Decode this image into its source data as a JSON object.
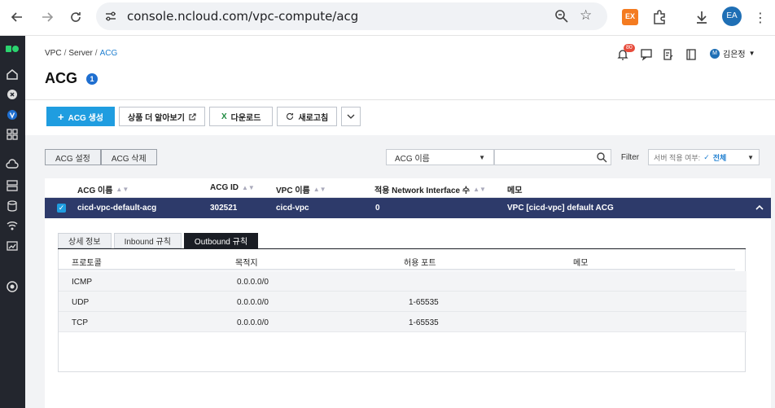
{
  "browser": {
    "url": "console.ncloud.com/vpc-compute/acg",
    "profile_initials": "EA",
    "extension_label": "EX"
  },
  "header": {
    "breadcrumb": [
      "VPC",
      "Server",
      "ACG"
    ],
    "title": "ACG",
    "title_badge": "1",
    "notification_count": "80",
    "user_initial": "M",
    "user_name": "김은정"
  },
  "toolbar": {
    "create_label": "ACG 생성",
    "learn_more_label": "상품 더 알아보기",
    "download_label": "다운로드",
    "refresh_label": "새로고침"
  },
  "actions": {
    "settings_label": "ACG 설정",
    "delete_label": "ACG 삭제"
  },
  "filter": {
    "field_select": "ACG 이름",
    "search_value": "",
    "filter_label": "Filter",
    "apply_label": "서버 적용 여부:",
    "apply_value": "전체"
  },
  "table": {
    "columns": [
      "ACG 이름",
      "ACG ID",
      "VPC 이름",
      "적용 Network Interface 수",
      "메모"
    ],
    "rows": [
      {
        "name": "cicd-vpc-default-acg",
        "id": "302521",
        "vpc": "cicd-vpc",
        "ni_count": "0",
        "memo": "VPC [cicd-vpc] default ACG",
        "selected": true
      }
    ]
  },
  "detail": {
    "tabs": [
      "상세 정보",
      "Inbound 규칙",
      "Outbound 규칙"
    ],
    "active_tab": "Outbound 규칙",
    "rule_columns": [
      "프로토콜",
      "목적지",
      "허용 포트",
      "메모"
    ],
    "rules": [
      {
        "protocol": "ICMP",
        "destination": "0.0.0.0/0",
        "port": "",
        "memo": ""
      },
      {
        "protocol": "UDP",
        "destination": "0.0.0.0/0",
        "port": "1-65535",
        "memo": ""
      },
      {
        "protocol": "TCP",
        "destination": "0.0.0.0/0",
        "port": "1-65535",
        "memo": ""
      }
    ]
  },
  "colors": {
    "primary": "#1f9de0",
    "selected_row": "#2d3a6a",
    "rail": "#23262e",
    "logo_green": "#2bd46f"
  }
}
